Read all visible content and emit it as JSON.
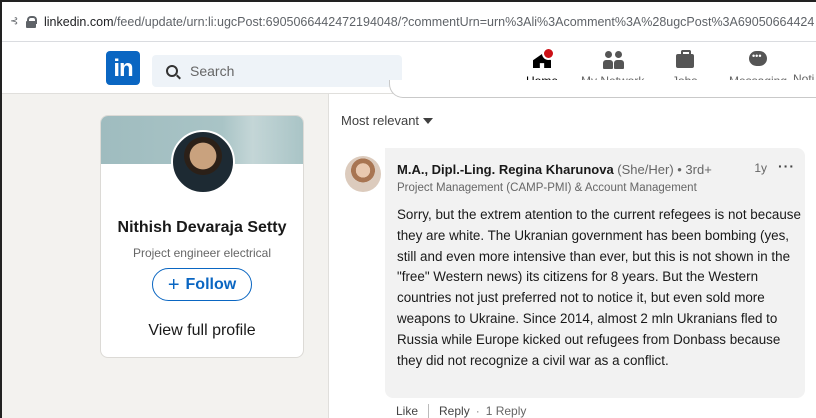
{
  "browser": {
    "url_host": "linkedin.com",
    "url_rest": "/feed/update/urn:li:ugcPost:6905066442472194048/?commentUrn=urn%3Ali%3Acomment%3A%28ugcPost%3A69050664424"
  },
  "nav": {
    "search_placeholder": "Search",
    "items": [
      {
        "label": "Home",
        "icon": "home-icon",
        "active": true
      },
      {
        "label": "My Network",
        "icon": "my-network-icon"
      },
      {
        "label": "Jobs",
        "icon": "jobs-icon"
      },
      {
        "label": "Messaging",
        "icon": "messaging-icon"
      },
      {
        "label": "Noti",
        "icon": "notifications-icon"
      }
    ]
  },
  "profile_card": {
    "name": "Nithish Devaraja Setty",
    "headline": "Project engineer electrical",
    "follow_label": "Follow",
    "view_profile_label": "View full profile"
  },
  "comments": {
    "sort_label": "Most relevant",
    "items": [
      {
        "author": "M.A., Dipl.-Ling. Regina Kharunova",
        "meta": "(She/Her) • 3rd+",
        "time": "1y",
        "title": "Project Management (CAMP-PMI) & Account Management",
        "text": "Sorry, but the extrem atention to the current refegees is not because they are white. The Ukranian government has been bombing (yes, still and even more intensive than ever, but this is not shown in the \"free\" Western news) its citizens for 8 years. But the Western countries not just preferred not to notice it, but even sold more weapons to Ukraine. Since 2014, almost 2 mln Ukranians fled to Russia while Europe kicked out refugees from Donbass because they did not recognize a civil war as a conflict.",
        "like_label": "Like",
        "reply_label": "Reply",
        "reply_count": "1 Reply"
      }
    ]
  },
  "colors": {
    "brand": "#0a66c2",
    "notification": "#cc1016"
  }
}
